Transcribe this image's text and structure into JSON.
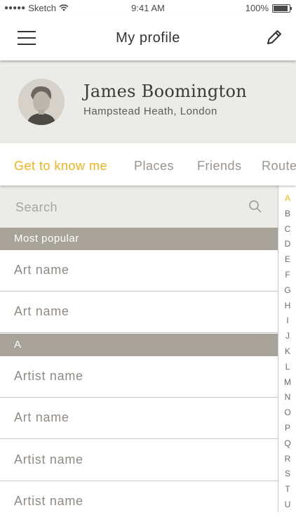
{
  "status_bar": {
    "carrier": "Sketch",
    "time": "9:41 AM",
    "battery": "100%"
  },
  "header": {
    "title": "My profile"
  },
  "profile": {
    "name": "James Boomington",
    "location": "Hampstead Heath, London"
  },
  "tabs": [
    {
      "label": "Get to know me",
      "active": true
    },
    {
      "label": "Places",
      "active": false
    },
    {
      "label": "Friends",
      "active": false
    },
    {
      "label": "Routes",
      "active": false
    }
  ],
  "search": {
    "placeholder": "Search"
  },
  "sections": [
    {
      "title": "Most popular",
      "items": [
        "Art name",
        "Art name"
      ]
    },
    {
      "title": "A",
      "items": [
        "Artist name",
        "Art name",
        "Artist name",
        "Artist name"
      ]
    }
  ],
  "alphabet_index": [
    "A",
    "B",
    "C",
    "D",
    "E",
    "F",
    "G",
    "H",
    "I",
    "J",
    "K",
    "L",
    "M",
    "N",
    "O",
    "P",
    "Q",
    "R",
    "S",
    "T",
    "U"
  ],
  "active_letter": "A",
  "colors": {
    "accent": "#f2b21c",
    "section_bg": "#a8a399",
    "panel_bg": "#ebebe7"
  }
}
